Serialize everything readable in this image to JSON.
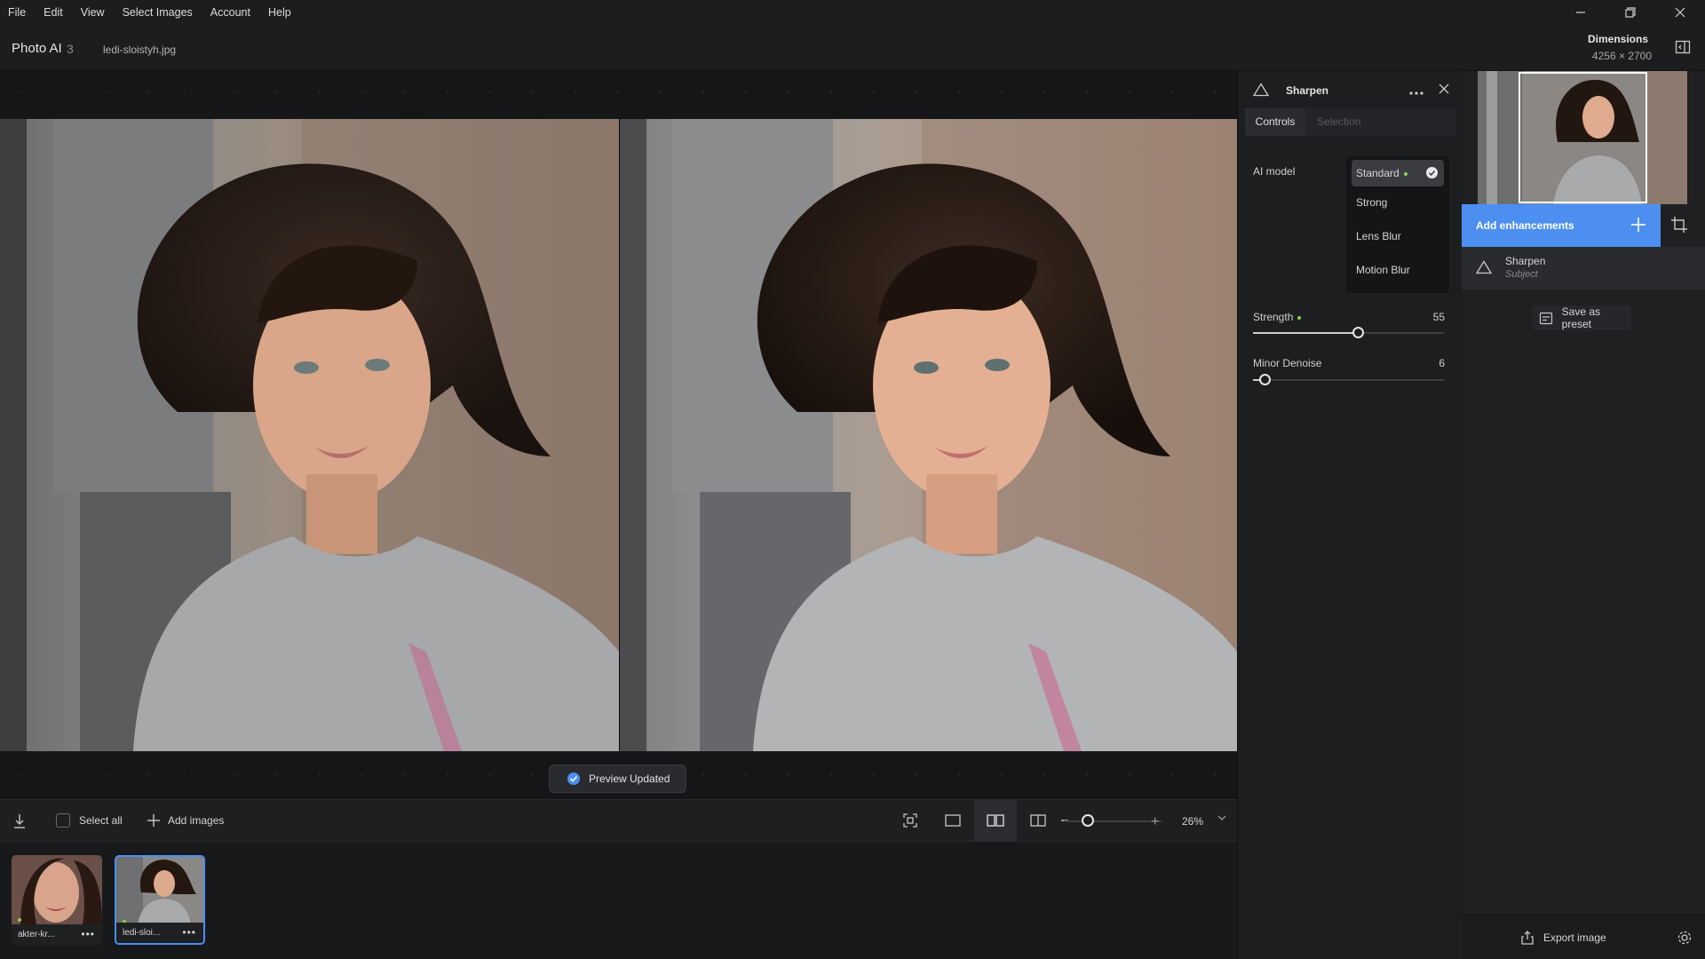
{
  "menu": [
    "File",
    "Edit",
    "View",
    "Select Images",
    "Account",
    "Help"
  ],
  "header": {
    "app_name": "Photo AI",
    "app_version": "3",
    "filename": "ledi-sloistyh.jpg",
    "dimensions_label": "Dimensions",
    "dimensions_value": "4256 × 2700"
  },
  "preview": {
    "toast": "Preview Updated"
  },
  "toolbar": {
    "select_all": "Select all",
    "add_images": "Add images",
    "zoom": "26%",
    "zoom_fraction": 0.15
  },
  "filmstrip": [
    {
      "name": "akter-kr...",
      "selected": false
    },
    {
      "name": "ledi-sloi...",
      "selected": true
    }
  ],
  "sharpen_panel": {
    "title": "Sharpen",
    "tabs": [
      "Controls",
      "Selection"
    ],
    "ai_model_label": "AI model",
    "ai_models": [
      "Standard",
      "Strong",
      "Lens Blur",
      "Motion Blur"
    ],
    "selected_model": "Standard",
    "strength": {
      "label": "Strength",
      "value": "55",
      "fraction": 0.55
    },
    "minor_denoise": {
      "label": "Minor Denoise",
      "value": "6",
      "fraction": 0.06
    }
  },
  "right_panel": {
    "add_enhancements": "Add enhancements",
    "enhancement": {
      "name": "Sharpen",
      "subtitle": "Subject"
    },
    "save_preset": "Save as preset",
    "export": "Export image"
  },
  "colors": {
    "accent": "#4d8ff0",
    "ok_dot": "#8cd04a"
  }
}
